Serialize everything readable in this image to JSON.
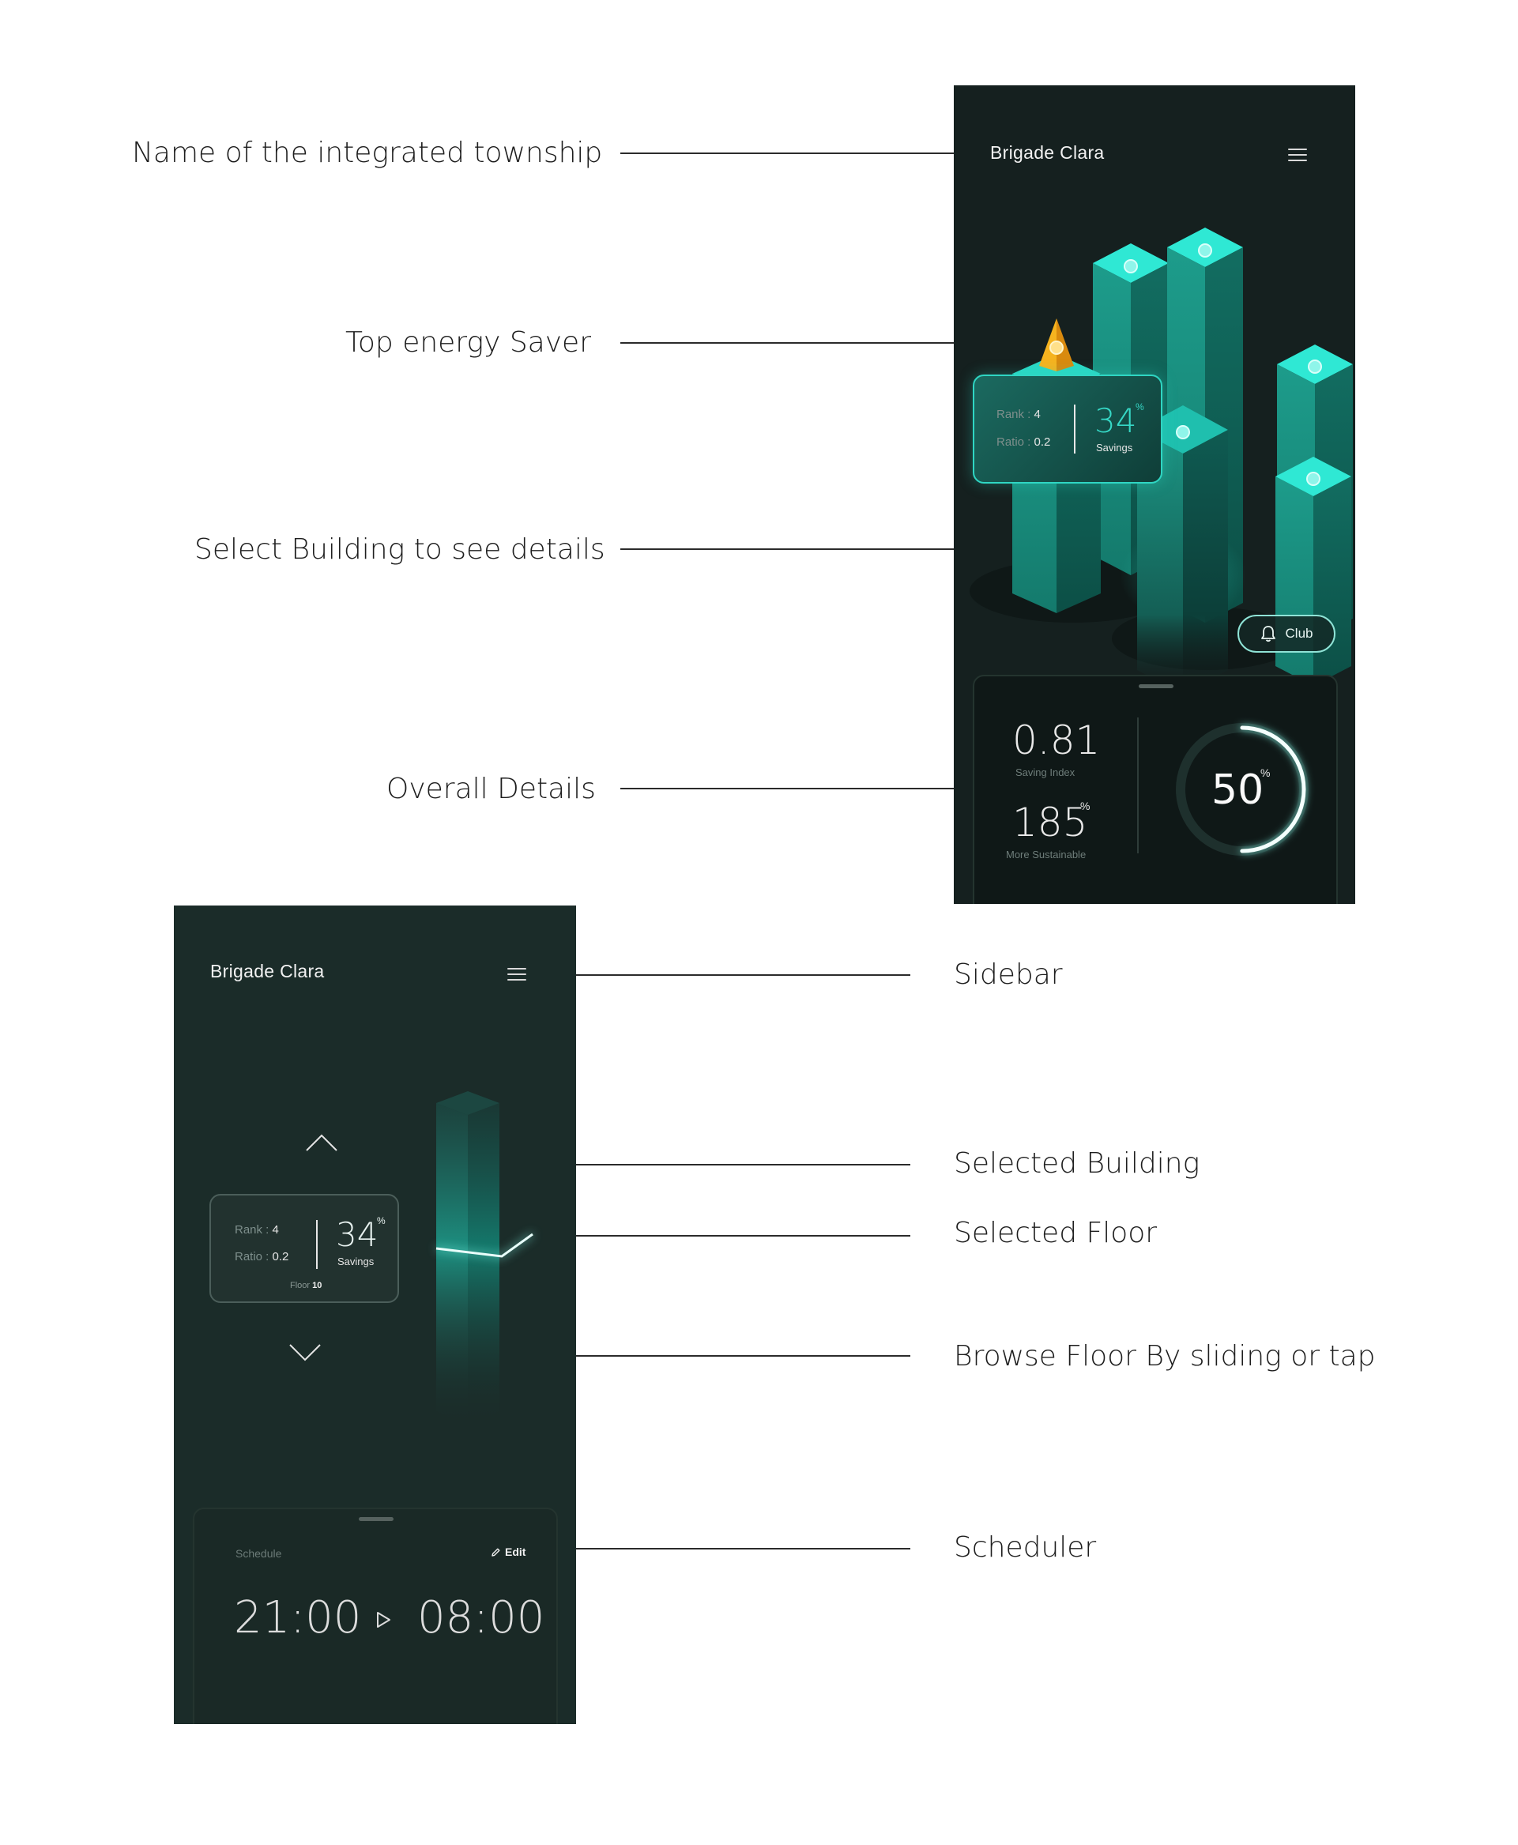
{
  "annotations": {
    "township_name": "Name of the  integrated township",
    "top_saver": "Top energy Saver",
    "select_building": "Select Building to see details",
    "overall_details": "Overall Details",
    "sidebar": "Sidebar",
    "selected_building": "Selected Building",
    "selected_floor": "Selected Floor",
    "browse_floor": "Browse Floor By sliding or tap",
    "scheduler": "Scheduler"
  },
  "screen_overview": {
    "app_title": "Brigade Clara",
    "menu_icon": "hamburger-menu-icon",
    "saver_card": {
      "rank_label": "Rank :",
      "rank_value": "4",
      "ratio_label": "Ratio :",
      "ratio_value": "0.2",
      "savings_value": "34",
      "savings_unit": "%",
      "savings_label": "Savings"
    },
    "club_button": {
      "label": "Club",
      "icon": "bell-icon"
    },
    "overall": {
      "saving_index_value": "0.81",
      "saving_index_label": "Saving Index",
      "sustainable_value": "185",
      "sustainable_unit": "%",
      "sustainable_label": "More Sustainable",
      "ring_value": "50",
      "ring_unit": "%",
      "ring_progress": 0.5
    }
  },
  "screen_building": {
    "app_title": "Brigade Clara",
    "menu_icon": "hamburger-menu-icon",
    "floor_card": {
      "rank_label": "Rank :",
      "rank_value": "4",
      "ratio_label": "Ratio :",
      "ratio_value": "0.2",
      "savings_value": "34",
      "savings_unit": "%",
      "savings_label": "Savings",
      "floor_label": "Floor",
      "floor_value": "10"
    },
    "scheduler": {
      "label": "Schedule",
      "edit_label": "Edit",
      "start_time": "21:00",
      "end_time": "08:00"
    }
  },
  "colors": {
    "accent_teal": "#2fd6c3",
    "building_teal": "#1f9a8a",
    "top_saver_gold": "#f0a516",
    "panel_dark": "#121b1a",
    "background": "#ffffff"
  }
}
